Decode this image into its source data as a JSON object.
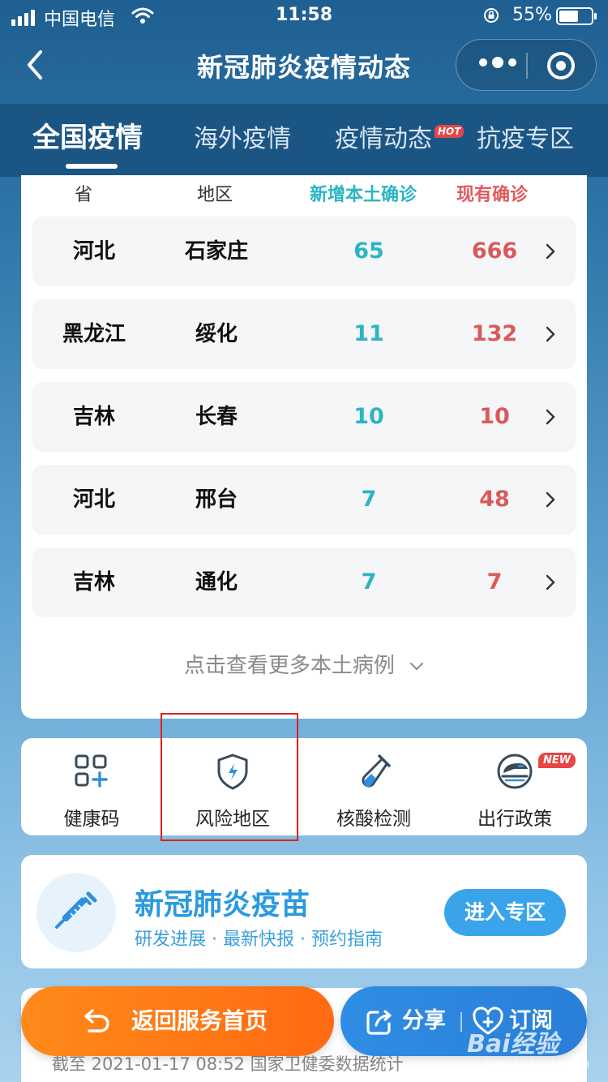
{
  "status_bar": {
    "carrier": "中国电信",
    "time": "11:58",
    "battery_percent": "55%",
    "battery_level": 0.55
  },
  "nav": {
    "title": "新冠肺炎疫情动态"
  },
  "tabs": [
    {
      "label": "全国疫情",
      "active": true
    },
    {
      "label": "海外疫情",
      "active": false
    },
    {
      "label": "疫情动态",
      "active": false,
      "badge": "HOT"
    },
    {
      "label": "抗疫专区",
      "active": false
    }
  ],
  "table": {
    "headers": {
      "province": "省",
      "area": "地区",
      "new_local": "新增本土确诊",
      "current": "现有确诊"
    },
    "rows": [
      {
        "province": "河北",
        "area": "石家庄",
        "new_local": "65",
        "current": "666"
      },
      {
        "province": "黑龙江",
        "area": "绥化",
        "new_local": "11",
        "current": "132"
      },
      {
        "province": "吉林",
        "area": "长春",
        "new_local": "10",
        "current": "10"
      },
      {
        "province": "河北",
        "area": "邢台",
        "new_local": "7",
        "current": "48"
      },
      {
        "province": "吉林",
        "area": "通化",
        "new_local": "7",
        "current": "7"
      }
    ],
    "more_label": "点击查看更多本土病例"
  },
  "services": [
    {
      "label": "健康码",
      "icon": "health-code-icon"
    },
    {
      "label": "风险地区",
      "icon": "shield-bolt-icon",
      "highlighted": true
    },
    {
      "label": "核酸检测",
      "icon": "test-tube-icon"
    },
    {
      "label": "出行政策",
      "icon": "train-icon",
      "badge": "NEW"
    }
  ],
  "vaccine": {
    "title": "新冠肺炎疫苗",
    "subtitle": "研发进展 · 最新快报 · 预约指南",
    "button": "进入专区",
    "icon": "syringe-icon"
  },
  "footer": {
    "home_button": "返回服务首页",
    "share_button": "分享",
    "subscribe_button": "订阅",
    "note": "截至 2021-01-17 08:52 国家卫健委数据统计"
  },
  "watermark": {
    "brand": "Bai经验",
    "url": "jingyan.baidu.com"
  },
  "colors": {
    "accent_teal": "#2bb5c4",
    "accent_red": "#d95a5a",
    "primary_blue": "#2a9adf",
    "orange": "#ff7a16"
  }
}
